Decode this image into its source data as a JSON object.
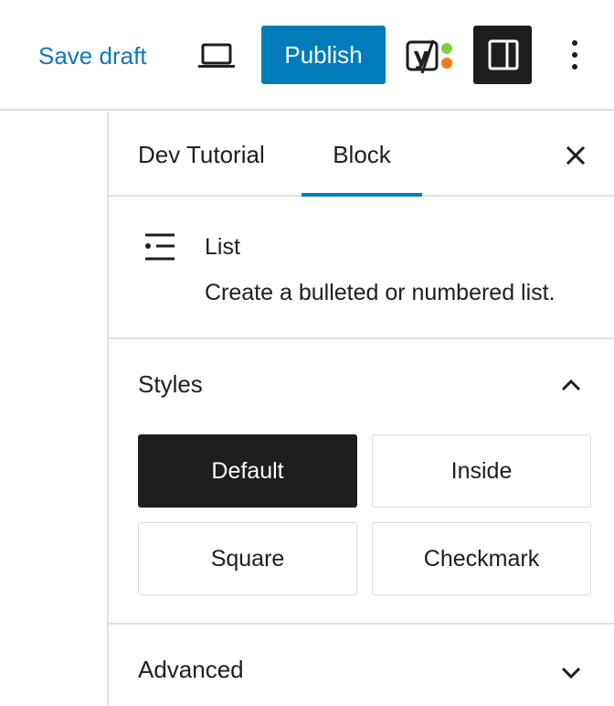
{
  "header": {
    "save_draft_label": "Save draft",
    "publish_label": "Publish",
    "yoast_letter": "y"
  },
  "sidebar": {
    "tabs": [
      {
        "label": "Dev Tutorial",
        "active": false
      },
      {
        "label": "Block",
        "active": true
      }
    ],
    "block": {
      "icon": "list-icon",
      "title": "List",
      "description": "Create a bulleted or numbered list."
    },
    "styles": {
      "title": "Styles",
      "expanded": true,
      "options": [
        {
          "label": "Default",
          "selected": true
        },
        {
          "label": "Inside",
          "selected": false
        },
        {
          "label": "Square",
          "selected": false
        },
        {
          "label": "Checkmark",
          "selected": false
        }
      ]
    },
    "advanced": {
      "title": "Advanced",
      "expanded": false
    }
  },
  "colors": {
    "accent": "#007cba",
    "link": "#0e78b8",
    "dark": "#1e1e1e",
    "border": "#e0e0e0",
    "yoast_green": "#7ad03a",
    "yoast_orange": "#ee7c1b"
  }
}
